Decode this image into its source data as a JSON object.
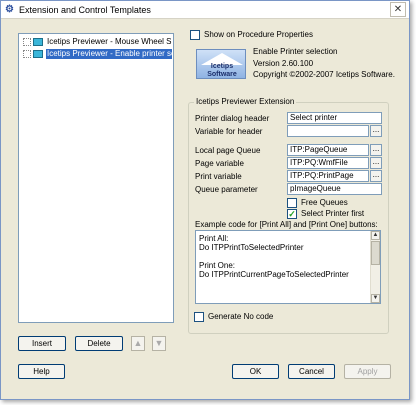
{
  "window": {
    "title": "Extension and Control Templates",
    "close_glyph": "✕"
  },
  "tree": {
    "items": [
      {
        "label": "Icetips Previewer - Mouse Wheel Sup",
        "selected": false
      },
      {
        "label": "Icetips Previewer - Enable printer sele",
        "selected": true
      }
    ]
  },
  "left_buttons": {
    "insert": "Insert",
    "delete": "Delete",
    "up_glyph": "▲",
    "down_glyph": "▼"
  },
  "top": {
    "show_on_procedure_properties": {
      "label": "Show on Procedure Properties",
      "checked": false
    }
  },
  "logo": {
    "line1": "Icetips",
    "line2": "Software"
  },
  "info": {
    "name": "Enable Printer selection",
    "version": "Version 2.60.100",
    "copyright": "Copyright ©2002-2007 Icetips Software."
  },
  "group": {
    "title": "Icetips Previewer Extension",
    "fields": {
      "printer_dialog_header": {
        "label": "Printer dialog header",
        "value": "Select printer"
      },
      "variable_for_header": {
        "label": "Variable for header",
        "value": ""
      },
      "local_page_queue": {
        "label": "Local page Queue",
        "value": "ITP:PageQueue"
      },
      "page_variable": {
        "label": "Page variable",
        "value": "ITP:PQ:WmfFile"
      },
      "print_variable": {
        "label": "Print variable",
        "value": "ITP:PQ:PrintPage"
      },
      "queue_parameter": {
        "label": "Queue parameter",
        "value": "pImageQueue"
      }
    },
    "free_queues": {
      "label": "Free Queues",
      "checked": false
    },
    "select_printer_first": {
      "label": "Select Printer first",
      "checked": true
    },
    "example_label": "Example code for [Print All] and [Print One] buttons:",
    "code_lines": [
      "Print All:",
      "  Do ITPPrintToSelectedPrinter",
      "",
      "Print One:",
      "  Do ITPPrintCurrentPageToSelectedPrinter"
    ],
    "generate_no_code": {
      "label": "Generate No code",
      "checked": false
    }
  },
  "bottom_buttons": {
    "help": "Help",
    "ok": "OK",
    "cancel": "Cancel",
    "apply": "Apply"
  },
  "glyphs": {
    "ellipsis": "...",
    "check": "✓"
  }
}
